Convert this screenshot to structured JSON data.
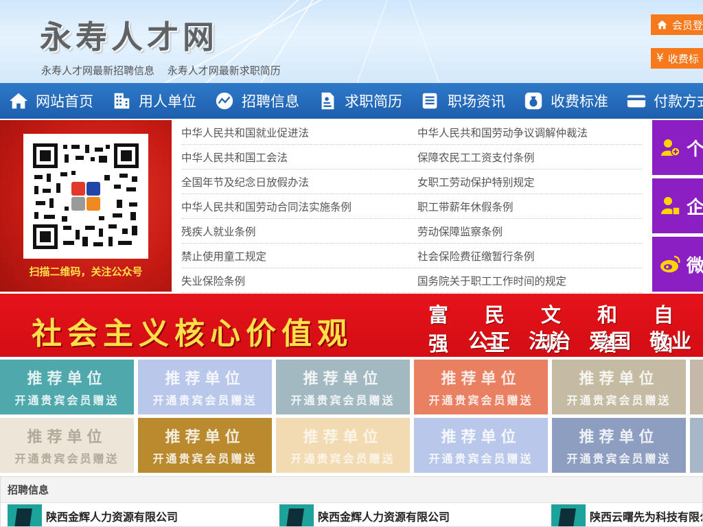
{
  "header": {
    "site_title": "永寿人才网",
    "links": [
      "永寿人才网最新招聘信息",
      "永寿人才网最新求职简历"
    ],
    "login_button": "会员登",
    "fee_button": "收费标"
  },
  "nav": {
    "items": [
      {
        "label": "网站首页",
        "icon": "home-icon"
      },
      {
        "label": "用人单位",
        "icon": "building-icon"
      },
      {
        "label": "招聘信息",
        "icon": "chart-icon"
      },
      {
        "label": "求职简历",
        "icon": "resume-icon"
      },
      {
        "label": "职场资讯",
        "icon": "news-icon"
      },
      {
        "label": "收费标准",
        "icon": "money-bag-icon"
      },
      {
        "label": "付款方式",
        "icon": "card-icon"
      }
    ]
  },
  "qr": {
    "caption": "扫描二维码，关注公众号"
  },
  "laws": [
    [
      "中华人民共和国就业促进法",
      "中华人民共和国劳动争议调解仲裁法"
    ],
    [
      "中华人民共和国工会法",
      "保障农民工工资支付条例"
    ],
    [
      "全国年节及纪念日放假办法",
      "女职工劳动保护特别规定"
    ],
    [
      "中华人民共和国劳动合同法实施条例",
      "职工带薪年休假条例"
    ],
    [
      "残疾人就业条例",
      "劳动保障监察条例"
    ],
    [
      "禁止使用童工规定",
      "社会保险费征缴暂行条例"
    ],
    [
      "失业保险条例",
      "国务院关于职工工作时间的规定"
    ]
  ],
  "side": [
    {
      "label": "个",
      "icon": "person-add-icon"
    },
    {
      "label": "企",
      "icon": "company-user-icon"
    },
    {
      "label": "微",
      "icon": "weibo-icon"
    }
  ],
  "banner": {
    "main": "社会主义核心价值观",
    "row1": [
      "富强",
      "民主",
      "文明",
      "和谐",
      "自由"
    ],
    "row2": [
      "公正",
      "法治",
      "爱国",
      "敬业"
    ]
  },
  "recommend": {
    "title": "推荐单位",
    "subtitle": "开通贵宾会员赠送",
    "colors": {
      "row1": [
        "#4fa8ac",
        "#b9c7ea",
        "#a2b9c2",
        "#e98062",
        "#c4bba2",
        "#c4b9a8"
      ],
      "row2": [
        "#ece6d9",
        "#b98a2e",
        "#f2dbb2",
        "#b9c7ea",
        "#8e9ec1",
        "#a8b6c9"
      ]
    }
  },
  "recruit": {
    "heading": "招聘信息",
    "companies": [
      "陕西金辉人力资源有限公司",
      "陕西金辉人力资源有限公司",
      "陕西云曙先为科技有限公司"
    ]
  }
}
